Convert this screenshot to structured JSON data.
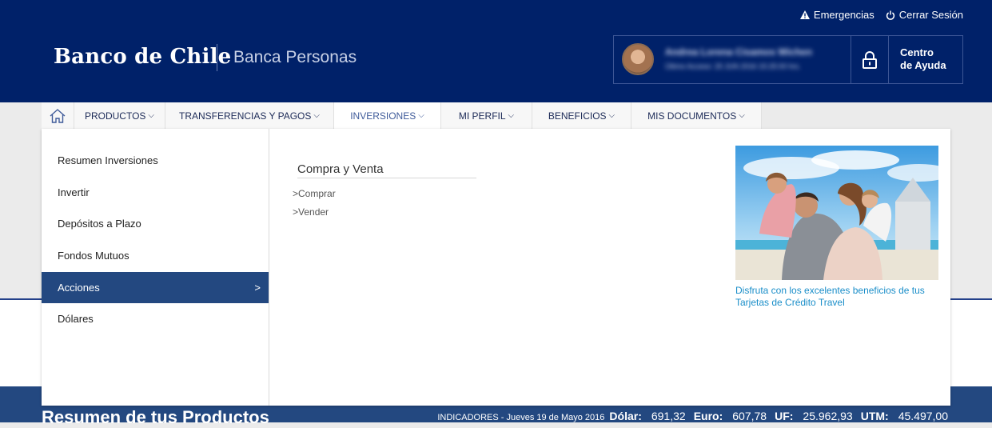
{
  "header": {
    "logo": "Banco de Chile",
    "section": "Banca Personas",
    "top_links": {
      "emergencias": "Emergencias",
      "cerrar_sesion": "Cerrar Sesión"
    },
    "user": {
      "name": "Andrea Lorena Cisamos Wichen",
      "last_access": "Último Acceso: 25 JUN 2016 15:25:00 hrs."
    },
    "help": {
      "line1": "Centro",
      "line2": "de Ayuda"
    }
  },
  "nav": {
    "items": [
      {
        "label": "PRODUCTOS"
      },
      {
        "label": "TRANSFERENCIAS Y PAGOS"
      },
      {
        "label": "INVERSIONES"
      },
      {
        "label": "MI PERFIL"
      },
      {
        "label": "BENEFICIOS"
      },
      {
        "label": "MIS DOCUMENTOS"
      }
    ],
    "active": "INVERSIONES"
  },
  "dropdown": {
    "menu": [
      {
        "label": "Resumen Inversiones"
      },
      {
        "label": "Invertir"
      },
      {
        "label": "Depósitos a Plazo"
      },
      {
        "label": "Fondos Mutuos"
      },
      {
        "label": "Acciones"
      },
      {
        "label": "Dólares"
      }
    ],
    "active": "Acciones",
    "content": {
      "title": "Compra y Venta",
      "links": [
        {
          "label": "Comprar"
        },
        {
          "label": "Vender"
        }
      ]
    },
    "promo": {
      "text": "Disfruta con los excelentes beneficios de tus Tarjetas de Crédito Travel"
    }
  },
  "page": {
    "title": "Resumen de tus Productos"
  },
  "indicators": {
    "date_label": "INDICADORES - Jueves 19 de Mayo 2016",
    "dolar_label": "Dólar:",
    "dolar_value": "691,32",
    "euro_label": "Euro:",
    "euro_value": "607,78",
    "uf_label": "UF:",
    "uf_value": "25.962,93",
    "utm_label": "UTM:",
    "utm_value": "45.497,00"
  }
}
